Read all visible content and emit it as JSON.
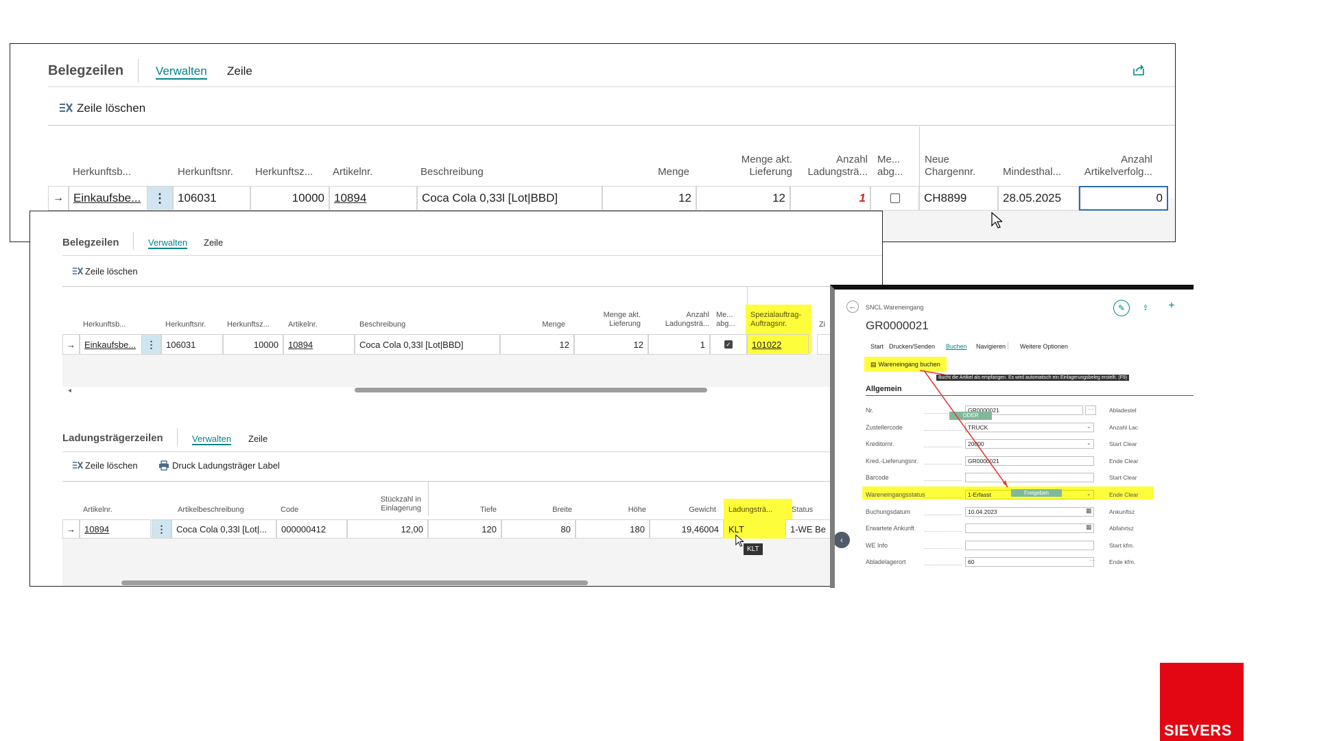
{
  "panel1": {
    "title": "Belegzeilen",
    "tabs": [
      "Verwalten",
      "Zeile"
    ],
    "action_delete": "Zeile löschen",
    "headers": [
      "Herkunftsb...",
      "Herkunftsnr.",
      "Herkunftsz...",
      "Artikelnr.",
      "Beschreibung",
      "Menge",
      "Menge akt.",
      "Lieferung",
      "Anzahl",
      "Ladungsträ...",
      "Me...",
      "abg...",
      "Neue",
      "Chargennr.",
      "Mindesthal...",
      "Anzahl",
      "Artikelverfolg..."
    ],
    "row": {
      "herkunftsb": "Einkaufsbe...",
      "herkunftsnr": "106031",
      "herkunftsz": "10000",
      "artikelnr": "10894",
      "beschreibung": "Coca Cola 0,33l [Lot|BBD]",
      "menge": "12",
      "menge_akt": "12",
      "anzahl_lt": "1",
      "charge": "CH8899",
      "mhd": "28.05.2025",
      "anzahl_av": "0"
    }
  },
  "panel2": {
    "title": "Belegzeilen",
    "tabs": [
      "Verwalten",
      "Zeile"
    ],
    "action_delete": "Zeile löschen",
    "headers": [
      "Herkunftsb...",
      "Herkunftsnr.",
      "Herkunftsz...",
      "Artikelnr.",
      "Beschreibung",
      "Menge",
      "Menge akt.",
      "Lieferung",
      "Anzahl",
      "Ladungsträ...",
      "Me...",
      "abg...",
      "Spezialauftrag-",
      "Auftragsnr.",
      "Zi"
    ],
    "row": {
      "herkunftsb": "Einkaufsbe...",
      "herkunftsnr": "106031",
      "herkunftsz": "10000",
      "artikelnr": "10894",
      "beschreibung": "Coca Cola 0,33l [Lot|BBD]",
      "menge": "12",
      "menge_akt": "12",
      "anzahl_lt": "1",
      "spezial": "101022"
    },
    "lt_section": {
      "title": "Ladungsträgerzeilen",
      "tabs": [
        "Verwalten",
        "Zeile"
      ],
      "action_delete": "Zeile löschen",
      "action_print": "Druck Ladungsträger Label",
      "headers": [
        "Artikelnr.",
        "Artikelbeschreibung",
        "Code",
        "Stückzahl in",
        "Einlagerung",
        "Tiefe",
        "Breite",
        "Höhe",
        "Gewicht",
        "Ladungsträ...",
        "Status"
      ],
      "row": {
        "artikelnr": "10894",
        "beschreibung": "Coca Cola 0,33l [Lot|...",
        "code": "000000412",
        "stueck": "12,00",
        "tiefe": "120",
        "breite": "80",
        "hoehe": "180",
        "gewicht": "19,46004",
        "lt": "KLT",
        "status": "1-WE Be"
      },
      "tooltip": "KLT"
    }
  },
  "panel3": {
    "breadcrumb": "SNCL Wareneingang",
    "doc_no": "GR0000021",
    "menu": [
      "Start",
      "Drucken/Senden",
      "Buchen",
      "Navigieren",
      "Weitere Optionen"
    ],
    "action_post": "Wareneingang buchen",
    "tooltip": "Bucht die Artikel als empfangen. Es wird automatisch ein Einlagerungsbeleg erstellt. (F9)",
    "section": "Allgemein",
    "oder": "ODER",
    "fields": [
      {
        "label": "Nr.",
        "value": "GR0000021",
        "right": "Abladestel"
      },
      {
        "label": "Zustellercode",
        "value": "TRUCK",
        "right": "Anzahl Lac"
      },
      {
        "label": "Kreditornr.",
        "value": "20000",
        "right": "Start Clear"
      },
      {
        "label": "Kred.-Lieferungsnr.",
        "value": "GR0000021",
        "right": "Ende Clear"
      },
      {
        "label": "Barcode",
        "value": "",
        "right": "Start Clear"
      },
      {
        "label": "Wareneingangsstatus",
        "value": "1-Erfasst",
        "right": "Ende Clear"
      },
      {
        "label": "Buchungsdatum",
        "value": "10.04.2023",
        "right": "Ankunftsz"
      },
      {
        "label": "Erwartete Ankunft",
        "value": "",
        "right": "Abfahrtsz"
      },
      {
        "label": "WE Info",
        "value": "",
        "right": "Start kfm."
      },
      {
        "label": "Abladelagerort",
        "value": "60",
        "right": "Ende kfm."
      }
    ],
    "release_button": "Freigeben"
  },
  "brand": {
    "name": "SIEVERS",
    "color": "#e30613"
  },
  "colors": {
    "accent": "#008489",
    "highlight": "#fdfd3c",
    "arrow": "#e53935"
  }
}
